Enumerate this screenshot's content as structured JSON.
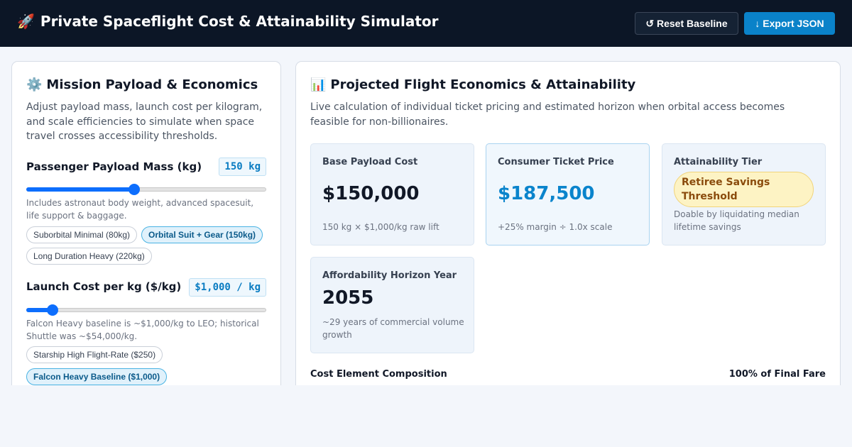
{
  "header": {
    "icon": "rocket-icon",
    "title": "Private Spaceflight Cost & Attainability Simulator",
    "reset_label": "↺ Reset Baseline",
    "export_label": "↓ Export JSON"
  },
  "controls": {
    "icon": "gear-icon",
    "title": "Mission Payload & Economics",
    "description": "Adjust payload mass, launch cost per kilogram, and scale efficiencies to simulate when space travel crosses accessibility thresholds.",
    "payload": {
      "label": "Passenger Payload Mass (kg)",
      "value_display": "150 kg",
      "slider_fraction": 0.45,
      "hint": "Includes astronaut body weight, advanced spacesuit, life support & baggage.",
      "presets": [
        {
          "label": "Suborbital Minimal (80kg)",
          "selected": false
        },
        {
          "label": "Orbital Suit + Gear (150kg)",
          "selected": true
        },
        {
          "label": "Long Duration Heavy (220kg)",
          "selected": false
        }
      ]
    },
    "launch_cost": {
      "label": "Launch Cost per kg ($/kg)",
      "value_display": "$1,000 / kg",
      "slider_fraction": 0.11,
      "hint": "Falcon Heavy baseline is ~$1,000/kg to LEO; historical Shuttle was ~$54,000/kg.",
      "presets": [
        {
          "label": "Starship High Flight-Rate ($250)",
          "selected": false
        },
        {
          "label": "Falcon Heavy Baseline ($1,000)",
          "selected": true
        }
      ]
    }
  },
  "results": {
    "icon": "bar-chart-icon",
    "title": "Projected Flight Economics & Attainability",
    "description": "Live calculation of individual ticket pricing and estimated horizon when orbital access becomes feasible for non-billionaires.",
    "cards": {
      "base_cost": {
        "label": "Base Payload Cost",
        "value": "$150,000",
        "note": "150 kg × $1,000/kg raw lift"
      },
      "ticket_price": {
        "label": "Consumer Ticket Price",
        "value": "$187,500",
        "note": "+25% margin ÷ 1.0x scale"
      },
      "tier": {
        "label": "Attainability Tier",
        "badge": "Retiree Savings Threshold",
        "note": "Doable by liquidating median lifetime savings"
      },
      "horizon": {
        "label": "Affordability Horizon Year",
        "value": "2055",
        "note": "~29 years of commercial volume growth"
      }
    },
    "composition": {
      "title": "Cost Element Composition",
      "total_label": "100% of Final Fare"
    }
  },
  "colors": {
    "header_bg": "#0c1626",
    "accent": "#0a82c9",
    "slider": "#0d6efd",
    "tier_bg": "#fdf3c4",
    "tier_text": "#8a4b0c"
  }
}
